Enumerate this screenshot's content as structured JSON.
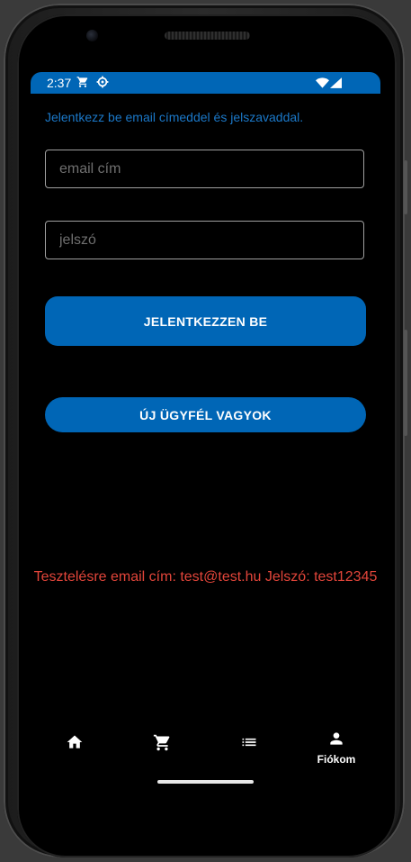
{
  "status_bar": {
    "time": "2:37",
    "background": "#0066b6",
    "icons": [
      "cart-icon",
      "settings-icon",
      "wifi-icon",
      "signal-icon"
    ]
  },
  "login": {
    "intro": "Jelentkezz be email címeddel és jelszavaddal.",
    "email_placeholder": "email cím",
    "email_value": "",
    "password_placeholder": "jelszó",
    "password_value": "",
    "login_button": "JELENTKEZZEN BE",
    "register_button": "ÚJ ÜGYFÉL VAGYOK",
    "test_note": "Tesztelésre email cím: test@test.hu Jelszó: test12345"
  },
  "colors": {
    "accent": "#0066b6",
    "intro_text": "#1b78c8",
    "note_text": "#e2453a"
  },
  "bottom_nav": {
    "items": [
      {
        "icon": "home-icon",
        "label": ""
      },
      {
        "icon": "cart-icon",
        "label": ""
      },
      {
        "icon": "list-icon",
        "label": ""
      },
      {
        "icon": "person-icon",
        "label": "Fiókom",
        "active": true
      }
    ]
  }
}
